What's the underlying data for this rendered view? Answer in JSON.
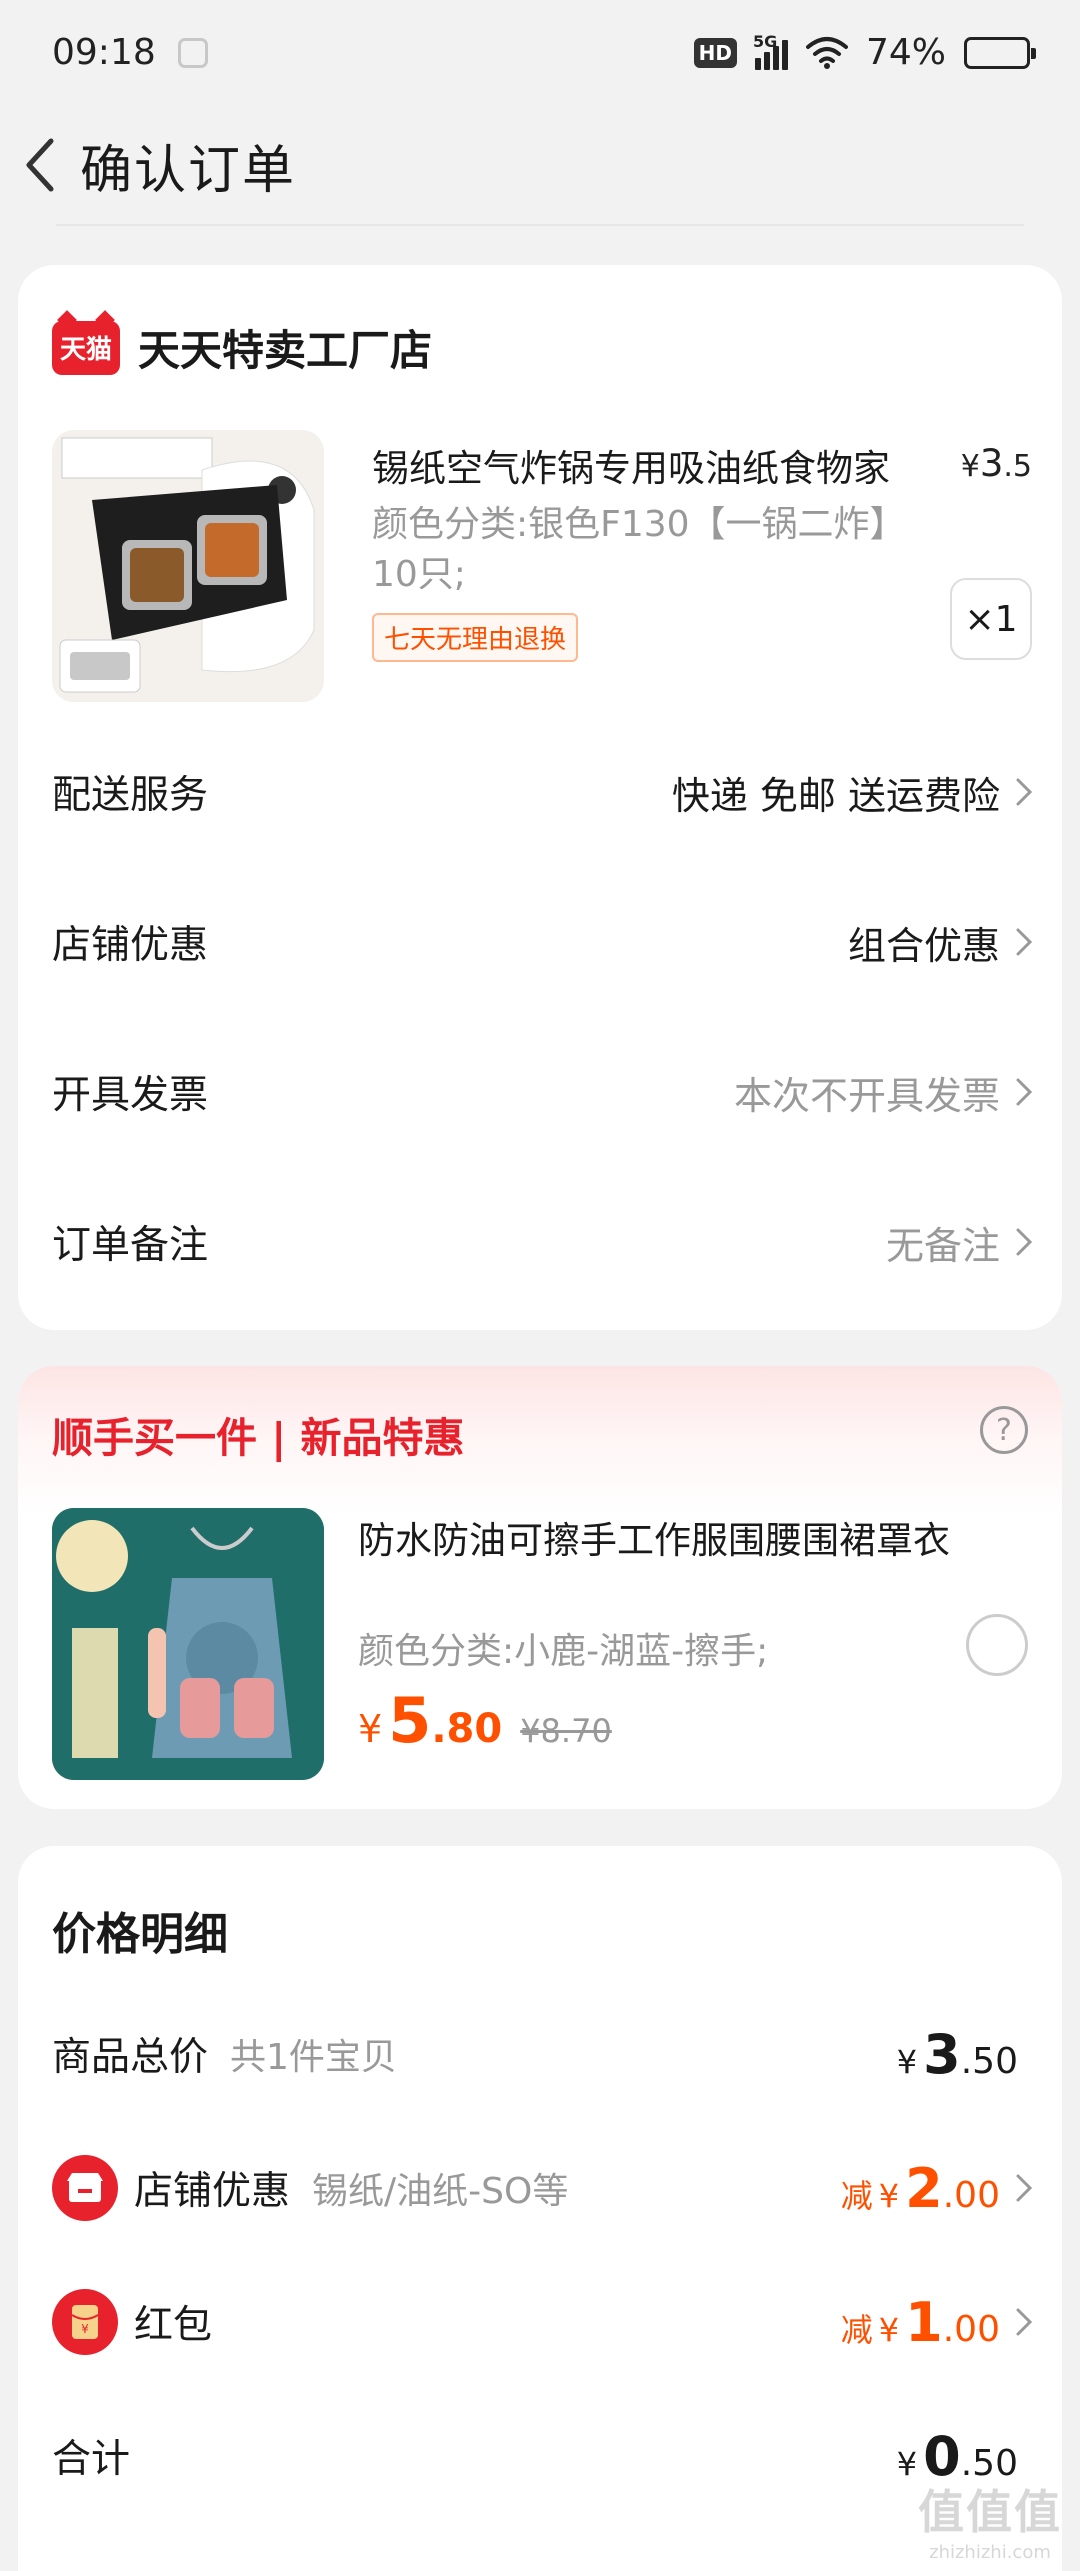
{
  "status_bar": {
    "time": "09:18",
    "signal_label": "5G",
    "battery": "74%",
    "battery_level": 0.74
  },
  "header": {
    "title": "确认订单"
  },
  "shop": {
    "logo_text": "天猫",
    "name": "天天特卖工厂店",
    "product": {
      "title": "锡纸空气炸锅专用吸油纸食物家",
      "price_symbol": "¥",
      "price_int": "3",
      "price_dec": ".5",
      "spec": "颜色分类:银色F130【一锅二炸】10只;",
      "return_tag": "七天无理由退换",
      "quantity": "×1"
    },
    "options": [
      {
        "label": "配送服务",
        "value": "快递 免邮 送运费险"
      },
      {
        "label": "店铺优惠",
        "value": "组合优惠"
      },
      {
        "label": "开具发票",
        "value": "本次不开具发票"
      },
      {
        "label": "订单备注",
        "value": "无备注"
      }
    ]
  },
  "promo": {
    "title": "顺手买一件 | 新品特惠",
    "product": {
      "title": "防水防油可擦手工作服围腰围裙罩衣",
      "spec": "颜色分类:小鹿-湖蓝-擦手;",
      "price_symbol": "¥",
      "price_int": "5",
      "price_dec": ".80",
      "original_price": "¥8.70"
    }
  },
  "price_detail": {
    "title": "价格明细",
    "rows": [
      {
        "label": "商品总价",
        "sub": "共1件宝贝",
        "prefix": "",
        "symbol": "¥",
        "int": "3",
        "dec": ".50"
      },
      {
        "label": "店铺优惠",
        "sub": "锡纸/油纸-SO等",
        "prefix": "减",
        "symbol": "¥",
        "int": "2",
        "dec": ".00"
      },
      {
        "label": "红包",
        "sub": "",
        "prefix": "减",
        "symbol": "¥",
        "int": "1",
        "dec": ".00"
      },
      {
        "label": "合计",
        "sub": "",
        "prefix": "",
        "symbol": "¥",
        "int": "0",
        "dec": ".50"
      }
    ]
  },
  "watermark": {
    "main": "值值值",
    "sub": "zhizhizhi.com"
  },
  "colors": {
    "accent": "#ff5000",
    "brand_red": "#e8222c",
    "muted": "#999999"
  }
}
